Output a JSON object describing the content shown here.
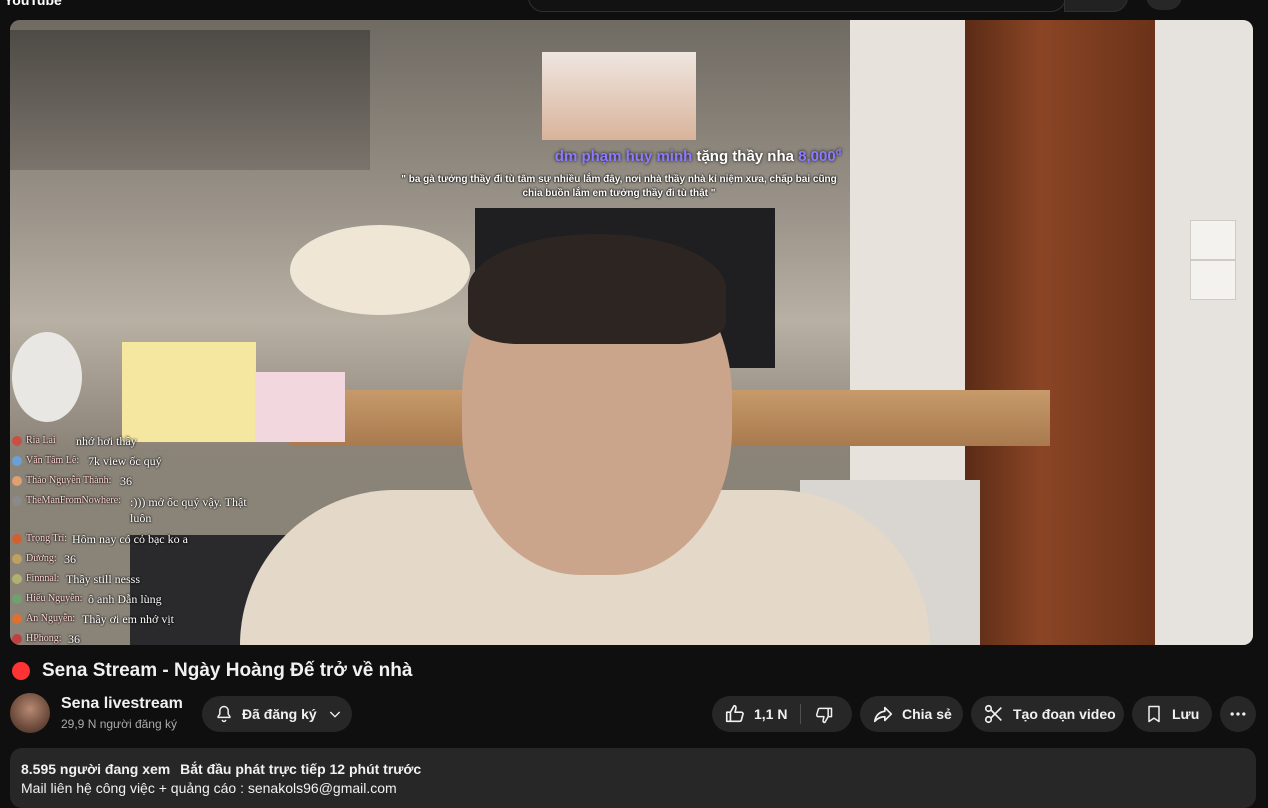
{
  "topbar": {
    "logo_text": "YouTube"
  },
  "player": {
    "donation": {
      "donor": "dm phạm huy minh",
      "action": "tặng thầy nha",
      "amount": "8,000",
      "currency": "đ",
      "message": "\" ba gà tưởng thầy đi tù tâm sự nhiều lắm đây, nơi nhà thầy nhà kỉ niệm xưa, chấp bai cũng chia buồn lắm em tưởng thầy đi tù thật \""
    },
    "chat": [
      {
        "user": "Ria Lai",
        "message": "nhớ hơi thầy"
      },
      {
        "user": "Văn Tâm Lê:",
        "message": "7k view ốc quý"
      },
      {
        "user": "Thảo Nguyễn Thành:",
        "message": "36"
      },
      {
        "user": "TheManFromNowhere:",
        "message": ":))) mở ốc quý vậy. Thật luôn"
      },
      {
        "user": "Trọng Trí:",
        "message": "Hôm nay có cỏ bạc ko a"
      },
      {
        "user": "Dương:",
        "message": "36"
      },
      {
        "user": "Finnnal:",
        "message": "Thầy still nesss"
      },
      {
        "user": "Hiếu Nguyễn:",
        "message": "ô anh Dẫn lùng"
      },
      {
        "user": "An Nguyễn:",
        "message": "Thầy ơi em nhớ vịt"
      },
      {
        "user": "HPhong:",
        "message": "36"
      }
    ]
  },
  "video": {
    "title": "Sena Stream - Ngày Hoàng Đế trở về nhà",
    "live_color": "#ff3333"
  },
  "channel": {
    "name": "Sena livestream",
    "subscribers": "29,9 N người đăng ký",
    "subscribe_label": "Đã đăng ký"
  },
  "actions": {
    "likes": "1,1 N",
    "share": "Chia sẻ",
    "clip": "Tạo đoạn video",
    "save": "Lưu"
  },
  "description": {
    "viewers": "8.595 người đang xem",
    "started": "Bắt đầu phát trực tiếp 12 phút trước",
    "line2": "Mail liên hệ công việc + quảng cáo : senakols96@gmail.com"
  },
  "colors": {
    "background": "#0f0f0f",
    "pill": "#272727",
    "donation_accent": "#8c7bff"
  }
}
